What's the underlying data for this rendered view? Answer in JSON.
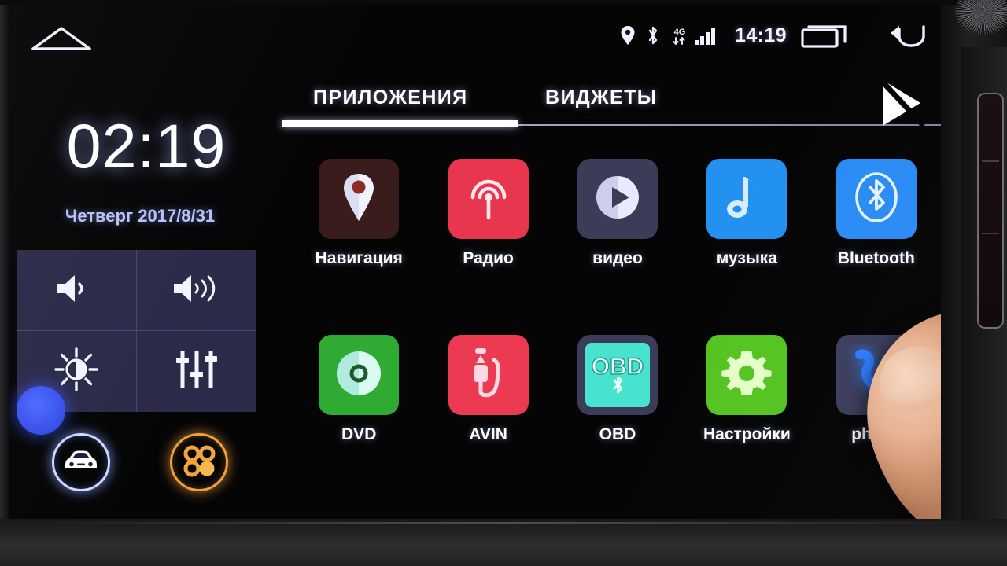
{
  "device": {
    "type": "android-car-head-unit",
    "screen_bg": "#050506"
  },
  "statusbar": {
    "home_icon": "home-icon",
    "icons": [
      {
        "name": "location-pin-icon",
        "label": "GPS"
      },
      {
        "name": "bluetooth-icon",
        "label": "Bluetooth"
      },
      {
        "name": "mobile-data-4g-icon",
        "label": "4G"
      },
      {
        "name": "signal-bars-icon",
        "label": "Signal"
      }
    ],
    "clock": "14:19",
    "recents_icon": "recents-icon",
    "back_icon": "back-arrow-icon"
  },
  "clock_widget": {
    "time": "02:19",
    "date": "Четверг 2017/8/31",
    "time_color": "#ffffff",
    "date_color": "#b9c2f7"
  },
  "controls": {
    "panel_bg": "#2b2a48",
    "items": [
      {
        "name": "volume-down-button",
        "icon": "volume-low-icon",
        "label": "Volume down"
      },
      {
        "name": "volume-up-button",
        "icon": "volume-high-icon",
        "label": "Volume up"
      },
      {
        "name": "brightness-button",
        "icon": "brightness-icon",
        "label": "Brightness"
      },
      {
        "name": "equalizer-button",
        "icon": "equalizer-icon",
        "label": "Equalizer"
      }
    ],
    "round_buttons": [
      {
        "name": "car-button",
        "icon": "car-icon",
        "color": "#cfd8ff"
      },
      {
        "name": "all-apps-button",
        "icon": "apps-grid-icon",
        "color": "#f0a13a"
      }
    ]
  },
  "tabs": {
    "items": [
      {
        "label": "ПРИЛОЖЕНИЯ",
        "active": true
      },
      {
        "label": "ВИДЖЕТЫ",
        "active": false
      }
    ],
    "playstore_icon": "play-store-icon"
  },
  "apps": [
    {
      "label": "Навигация",
      "icon": "map-pin-icon",
      "tile": "#3a1c1c",
      "glyph": "#f0f2ff"
    },
    {
      "label": "Радио",
      "icon": "radio-waves-icon",
      "tile": "#e8364f",
      "glyph": "#ffe9ec"
    },
    {
      "label": "видео",
      "icon": "play-circle-icon",
      "tile": "#3b3c58",
      "glyph": "#e6e8ff"
    },
    {
      "label": "музыка",
      "icon": "music-note-icon",
      "tile": "#2391f0",
      "glyph": "#d8ecff"
    },
    {
      "label": "Bluetooth",
      "icon": "bluetooth-icon",
      "tile": "#2b8cf5",
      "glyph": "#e4f1ff"
    },
    {
      "label": "DVD",
      "icon": "disc-icon",
      "tile": "#2faa33",
      "glyph": "#d9fbf2"
    },
    {
      "label": "AVIN",
      "icon": "av-plug-icon",
      "tile": "#ec3a52",
      "glyph": "#ffd9e2"
    },
    {
      "label": "OBD",
      "icon": "obd-icon",
      "tile": "#47e3cf",
      "glyph": "#0f7a6c"
    },
    {
      "label": "Настройки",
      "icon": "gear-icon",
      "tile": "#55c422",
      "glyph": "#e4ffc8"
    },
    {
      "label": "phone",
      "icon": "phone-handset-icon",
      "tile": "#3c3e5e",
      "glyph": "#2b7bff"
    }
  ],
  "touch": {
    "finger_present": true,
    "target_app": "phone"
  }
}
